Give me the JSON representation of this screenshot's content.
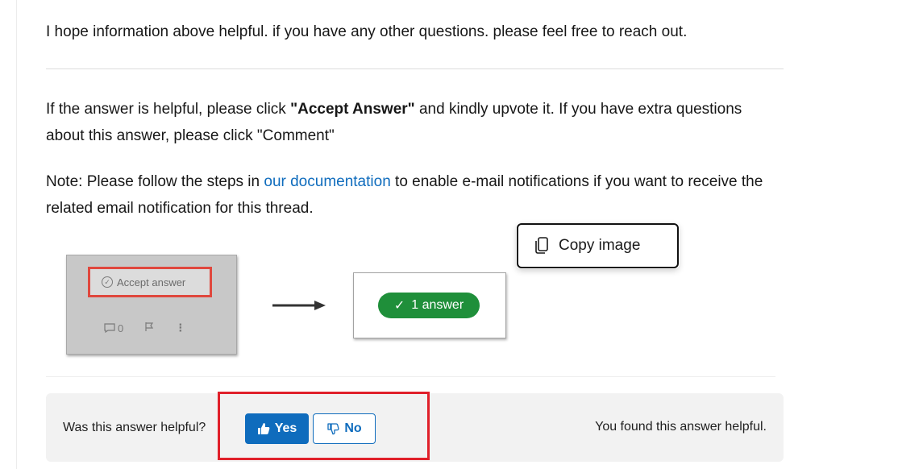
{
  "answer": {
    "closing_line": "I hope information above helpful. if you have any other questions. please feel free to reach out.",
    "accept_note_pre": "If the answer is helpful, please click ",
    "accept_note_bold": "\"Accept Answer\"",
    "accept_note_post": " and kindly upvote it. If you have extra questions about this answer, please click \"Comment\"",
    "notification_pre": "Note: Please follow the steps in ",
    "notification_link": "our documentation",
    "notification_post": " to enable e-mail notifications if you want to receive the related email notification for this thread."
  },
  "illustration": {
    "accept_label": "Accept answer",
    "comment_count": "0",
    "answer_badge": "1 answer",
    "icons": [
      "circle-check-icon",
      "comment-icon",
      "flag-icon",
      "more-icon",
      "arrow-right-icon",
      "checkmark-icon"
    ]
  },
  "context_menu": {
    "copy_image_label": "Copy image",
    "icon": "copy-icon"
  },
  "feedback": {
    "question": "Was this answer helpful?",
    "yes_label": "Yes",
    "no_label": "No",
    "status": "You found this answer helpful.",
    "icons": [
      "thumbs-up-icon",
      "thumbs-down-icon"
    ]
  },
  "colors": {
    "link": "#0f6cbd",
    "yes_button": "#0f6cbd",
    "answer_badge": "#1f8f3a",
    "highlight": "#e0202a",
    "accept_highlight": "#e0473d"
  }
}
